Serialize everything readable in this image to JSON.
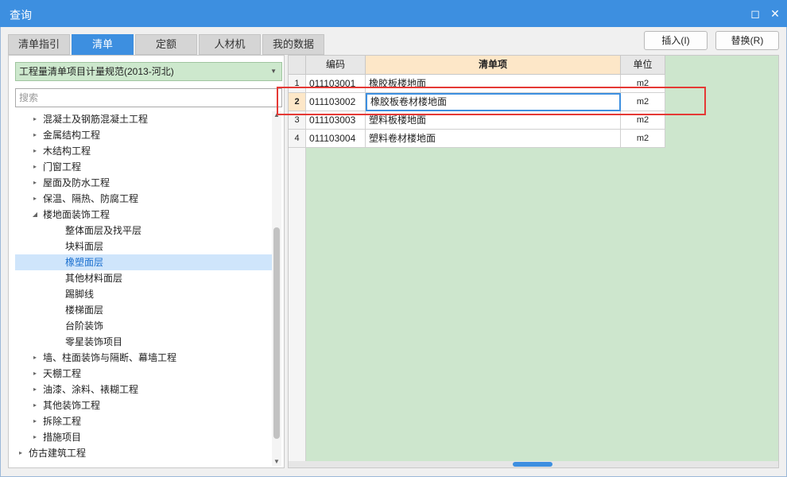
{
  "window": {
    "title": "查询",
    "restore_glyph": "◻",
    "close_glyph": "✕"
  },
  "tabs": [
    {
      "label": "清单指引",
      "active": false
    },
    {
      "label": "清单",
      "active": true
    },
    {
      "label": "定额",
      "active": false
    },
    {
      "label": "人材机",
      "active": false
    },
    {
      "label": "我的数据",
      "active": false
    }
  ],
  "toolbar": {
    "insert_label": "插入(I)",
    "replace_label": "替换(R)"
  },
  "left": {
    "spec_select": "工程量清单项目计量规范(2013-河北)",
    "search_placeholder": "搜索",
    "tree": [
      {
        "label": "混凝土及钢筋混凝土工程",
        "level": 1,
        "expander": "▸",
        "selected": false
      },
      {
        "label": "金属结构工程",
        "level": 1,
        "expander": "▸",
        "selected": false
      },
      {
        "label": "木结构工程",
        "level": 1,
        "expander": "▸",
        "selected": false
      },
      {
        "label": "门窗工程",
        "level": 1,
        "expander": "▸",
        "selected": false
      },
      {
        "label": "屋面及防水工程",
        "level": 1,
        "expander": "▸",
        "selected": false
      },
      {
        "label": "保温、隔热、防腐工程",
        "level": 1,
        "expander": "▸",
        "selected": false
      },
      {
        "label": "楼地面装饰工程",
        "level": 1,
        "expander": "◢",
        "selected": false
      },
      {
        "label": "整体面层及找平层",
        "level": 2,
        "expander": "",
        "selected": false
      },
      {
        "label": "块料面层",
        "level": 2,
        "expander": "",
        "selected": false
      },
      {
        "label": "橡塑面层",
        "level": 2,
        "expander": "",
        "selected": true
      },
      {
        "label": "其他材料面层",
        "level": 2,
        "expander": "",
        "selected": false
      },
      {
        "label": "踢脚线",
        "level": 2,
        "expander": "",
        "selected": false
      },
      {
        "label": "楼梯面层",
        "level": 2,
        "expander": "",
        "selected": false
      },
      {
        "label": "台阶装饰",
        "level": 2,
        "expander": "",
        "selected": false
      },
      {
        "label": "零星装饰项目",
        "level": 2,
        "expander": "",
        "selected": false
      },
      {
        "label": "墙、柱面装饰与隔断、幕墙工程",
        "level": 1,
        "expander": "▸",
        "selected": false
      },
      {
        "label": "天棚工程",
        "level": 1,
        "expander": "▸",
        "selected": false
      },
      {
        "label": "油漆、涂料、裱糊工程",
        "level": 1,
        "expander": "▸",
        "selected": false
      },
      {
        "label": "其他装饰工程",
        "level": 1,
        "expander": "▸",
        "selected": false
      },
      {
        "label": "拆除工程",
        "level": 1,
        "expander": "▸",
        "selected": false
      },
      {
        "label": "措施项目",
        "level": 1,
        "expander": "▸",
        "selected": false
      },
      {
        "label": "仿古建筑工程",
        "level": 0,
        "expander": "▸",
        "selected": false
      }
    ]
  },
  "grid": {
    "columns": [
      "编码",
      "清单项",
      "单位"
    ],
    "rows": [
      {
        "num": "1",
        "code": "011103001",
        "name": "橡胶板楼地面",
        "unit": "m2",
        "current": false
      },
      {
        "num": "2",
        "code": "011103002",
        "name": "橡胶板卷材楼地面",
        "unit": "m2",
        "current": true
      },
      {
        "num": "3",
        "code": "011103003",
        "name": "塑料板楼地面",
        "unit": "m2",
        "current": false
      },
      {
        "num": "4",
        "code": "011103004",
        "name": "塑料卷材楼地面",
        "unit": "m2",
        "current": false
      }
    ]
  },
  "colors": {
    "accent": "#3d8fe0",
    "grid_bg": "#cde6cd",
    "highlight_box": "#e53935",
    "header_highlight": "#fde7c8"
  }
}
